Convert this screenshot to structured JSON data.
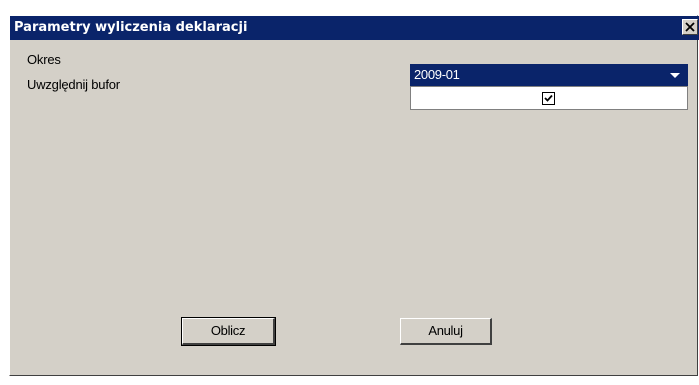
{
  "window": {
    "title": "Parametry wyliczenia deklaracji",
    "close_icon": "close-icon"
  },
  "form": {
    "okres_label": "Okres",
    "okres_value": "2009-01",
    "bufor_label": "Uwzględnij bufor",
    "bufor_checked": true
  },
  "buttons": {
    "oblicz_label": "Oblicz",
    "anuluj_label": "Anuluj"
  },
  "colors": {
    "titlebar": "#0a246a",
    "dialog_bg": "#d4d0c8",
    "selection": "#0a246a"
  }
}
